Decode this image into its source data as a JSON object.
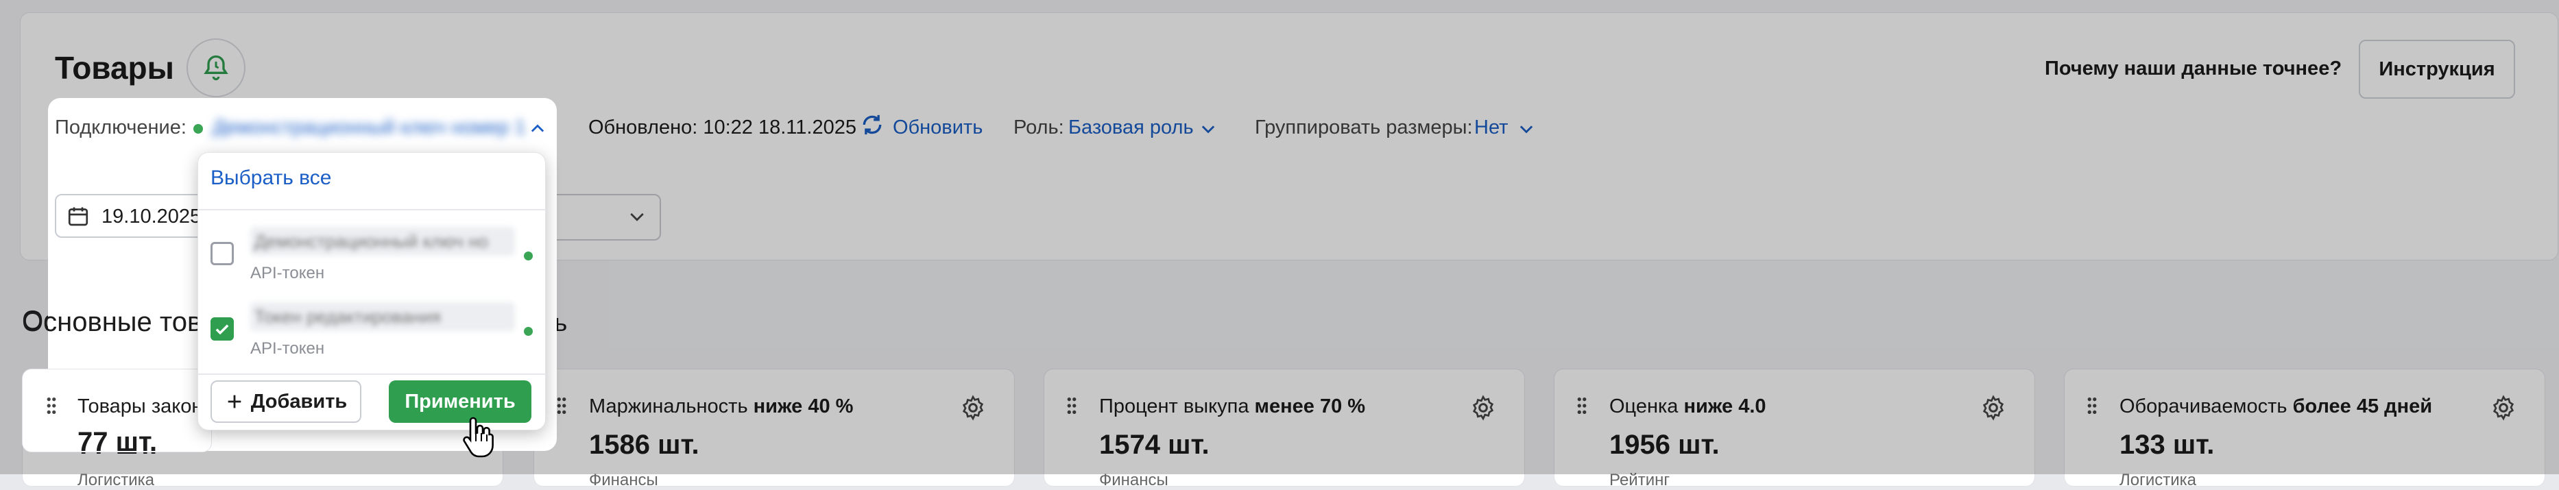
{
  "header": {
    "title": "Товары",
    "why_label": "Почему наши данные точнее?",
    "instruction_label": "Инструкция"
  },
  "connection": {
    "label": "Подключение:",
    "value": "Демонстрационный ключ номер 1",
    "updated": "Обновлено: 10:22 18.11.2025",
    "refresh_label": "Обновить",
    "role_label": "Роль:",
    "role_value": "Базовая роль",
    "group_label": "Группировать размеры:",
    "group_value": "Нет"
  },
  "date": {
    "value": "19.10.2025"
  },
  "section": {
    "title": "Основные товары",
    "link": "ть"
  },
  "dropdown": {
    "select_all": "Выбрать все",
    "options": [
      {
        "name": "Демонстрационный ключ но",
        "sub": "API-токен",
        "checked": false
      },
      {
        "name": "Токен редактирования",
        "sub": "API-токен",
        "checked": true
      }
    ],
    "add_label": "Добавить",
    "apply_label": "Применить"
  },
  "cards": [
    {
      "label": "Товары закон",
      "bold": "",
      "value": "77 шт.",
      "category": "Логистика"
    },
    {
      "label": "Маржинальность",
      "bold": "ниже 40 %",
      "value": "1586 шт.",
      "category": "Финансы"
    },
    {
      "label": "Процент выкупа",
      "bold": "менее 70 %",
      "value": "1574 шт.",
      "category": "Финансы"
    },
    {
      "label": "Оценка",
      "bold": "ниже 4.0",
      "value": "1956 шт.",
      "category": "Рейтинг"
    },
    {
      "label": "Оборачиваемость",
      "bold": "более 45 дней",
      "value": "133 шт.",
      "category": "Логистика"
    }
  ],
  "colors": {
    "accent": "#1a5ec6",
    "apply": "#2f9e4f",
    "status": "#3aa655"
  }
}
